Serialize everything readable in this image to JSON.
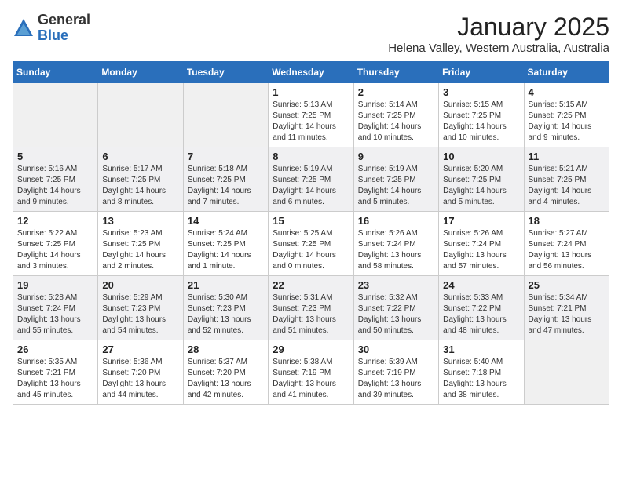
{
  "logo": {
    "general": "General",
    "blue": "Blue"
  },
  "title": "January 2025",
  "subtitle": "Helena Valley, Western Australia, Australia",
  "weekdays": [
    "Sunday",
    "Monday",
    "Tuesday",
    "Wednesday",
    "Thursday",
    "Friday",
    "Saturday"
  ],
  "weeks": [
    [
      {
        "day": "",
        "info": ""
      },
      {
        "day": "",
        "info": ""
      },
      {
        "day": "",
        "info": ""
      },
      {
        "day": "1",
        "info": "Sunrise: 5:13 AM\nSunset: 7:25 PM\nDaylight: 14 hours\nand 11 minutes."
      },
      {
        "day": "2",
        "info": "Sunrise: 5:14 AM\nSunset: 7:25 PM\nDaylight: 14 hours\nand 10 minutes."
      },
      {
        "day": "3",
        "info": "Sunrise: 5:15 AM\nSunset: 7:25 PM\nDaylight: 14 hours\nand 10 minutes."
      },
      {
        "day": "4",
        "info": "Sunrise: 5:15 AM\nSunset: 7:25 PM\nDaylight: 14 hours\nand 9 minutes."
      }
    ],
    [
      {
        "day": "5",
        "info": "Sunrise: 5:16 AM\nSunset: 7:25 PM\nDaylight: 14 hours\nand 9 minutes."
      },
      {
        "day": "6",
        "info": "Sunrise: 5:17 AM\nSunset: 7:25 PM\nDaylight: 14 hours\nand 8 minutes."
      },
      {
        "day": "7",
        "info": "Sunrise: 5:18 AM\nSunset: 7:25 PM\nDaylight: 14 hours\nand 7 minutes."
      },
      {
        "day": "8",
        "info": "Sunrise: 5:19 AM\nSunset: 7:25 PM\nDaylight: 14 hours\nand 6 minutes."
      },
      {
        "day": "9",
        "info": "Sunrise: 5:19 AM\nSunset: 7:25 PM\nDaylight: 14 hours\nand 5 minutes."
      },
      {
        "day": "10",
        "info": "Sunrise: 5:20 AM\nSunset: 7:25 PM\nDaylight: 14 hours\nand 5 minutes."
      },
      {
        "day": "11",
        "info": "Sunrise: 5:21 AM\nSunset: 7:25 PM\nDaylight: 14 hours\nand 4 minutes."
      }
    ],
    [
      {
        "day": "12",
        "info": "Sunrise: 5:22 AM\nSunset: 7:25 PM\nDaylight: 14 hours\nand 3 minutes."
      },
      {
        "day": "13",
        "info": "Sunrise: 5:23 AM\nSunset: 7:25 PM\nDaylight: 14 hours\nand 2 minutes."
      },
      {
        "day": "14",
        "info": "Sunrise: 5:24 AM\nSunset: 7:25 PM\nDaylight: 14 hours\nand 1 minute."
      },
      {
        "day": "15",
        "info": "Sunrise: 5:25 AM\nSunset: 7:25 PM\nDaylight: 14 hours\nand 0 minutes."
      },
      {
        "day": "16",
        "info": "Sunrise: 5:26 AM\nSunset: 7:24 PM\nDaylight: 13 hours\nand 58 minutes."
      },
      {
        "day": "17",
        "info": "Sunrise: 5:26 AM\nSunset: 7:24 PM\nDaylight: 13 hours\nand 57 minutes."
      },
      {
        "day": "18",
        "info": "Sunrise: 5:27 AM\nSunset: 7:24 PM\nDaylight: 13 hours\nand 56 minutes."
      }
    ],
    [
      {
        "day": "19",
        "info": "Sunrise: 5:28 AM\nSunset: 7:24 PM\nDaylight: 13 hours\nand 55 minutes."
      },
      {
        "day": "20",
        "info": "Sunrise: 5:29 AM\nSunset: 7:23 PM\nDaylight: 13 hours\nand 54 minutes."
      },
      {
        "day": "21",
        "info": "Sunrise: 5:30 AM\nSunset: 7:23 PM\nDaylight: 13 hours\nand 52 minutes."
      },
      {
        "day": "22",
        "info": "Sunrise: 5:31 AM\nSunset: 7:23 PM\nDaylight: 13 hours\nand 51 minutes."
      },
      {
        "day": "23",
        "info": "Sunrise: 5:32 AM\nSunset: 7:22 PM\nDaylight: 13 hours\nand 50 minutes."
      },
      {
        "day": "24",
        "info": "Sunrise: 5:33 AM\nSunset: 7:22 PM\nDaylight: 13 hours\nand 48 minutes."
      },
      {
        "day": "25",
        "info": "Sunrise: 5:34 AM\nSunset: 7:21 PM\nDaylight: 13 hours\nand 47 minutes."
      }
    ],
    [
      {
        "day": "26",
        "info": "Sunrise: 5:35 AM\nSunset: 7:21 PM\nDaylight: 13 hours\nand 45 minutes."
      },
      {
        "day": "27",
        "info": "Sunrise: 5:36 AM\nSunset: 7:20 PM\nDaylight: 13 hours\nand 44 minutes."
      },
      {
        "day": "28",
        "info": "Sunrise: 5:37 AM\nSunset: 7:20 PM\nDaylight: 13 hours\nand 42 minutes."
      },
      {
        "day": "29",
        "info": "Sunrise: 5:38 AM\nSunset: 7:19 PM\nDaylight: 13 hours\nand 41 minutes."
      },
      {
        "day": "30",
        "info": "Sunrise: 5:39 AM\nSunset: 7:19 PM\nDaylight: 13 hours\nand 39 minutes."
      },
      {
        "day": "31",
        "info": "Sunrise: 5:40 AM\nSunset: 7:18 PM\nDaylight: 13 hours\nand 38 minutes."
      },
      {
        "day": "",
        "info": ""
      }
    ]
  ]
}
